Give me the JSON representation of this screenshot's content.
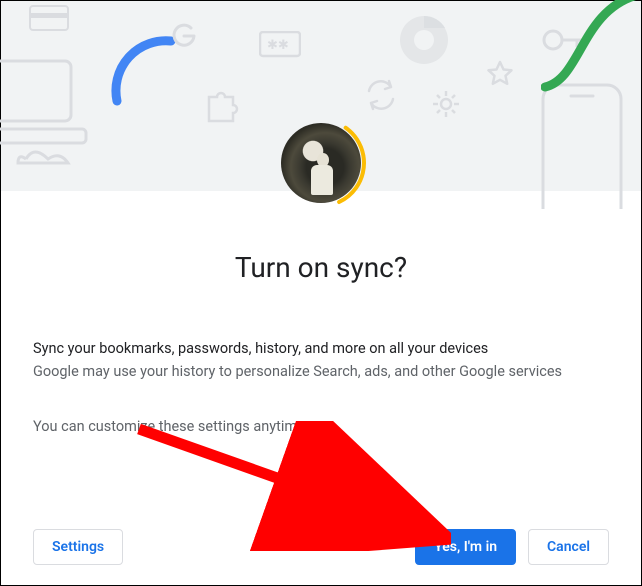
{
  "title": "Turn on sync?",
  "description_primary": "Sync your bookmarks, passwords, history, and more on all your devices",
  "description_secondary": "Google may use your history to personalize Search, ads, and other Google services",
  "customize_note": "You can customize these settings anytime",
  "buttons": {
    "settings": "Settings",
    "confirm": "Yes, I'm in",
    "cancel": "Cancel"
  },
  "colors": {
    "accent_blue": "#1a73e8",
    "google_blue": "#4285f4",
    "google_green": "#34a853",
    "google_yellow": "#fbbc04",
    "text_primary": "#202124",
    "text_secondary": "#5f6368",
    "hero_bg": "#f1f3f4",
    "stroke": "#dadce0"
  }
}
